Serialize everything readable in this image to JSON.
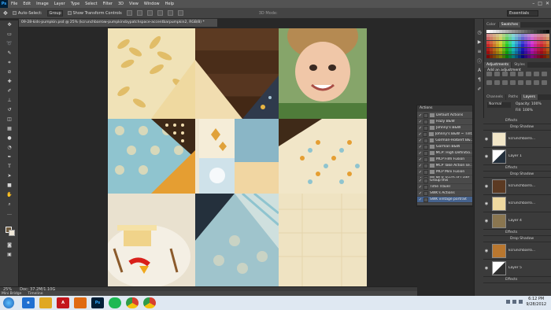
{
  "app": {
    "logo": "Ps",
    "menu": [
      "File",
      "Edit",
      "Image",
      "Layer",
      "Type",
      "Select",
      "Filter",
      "3D",
      "View",
      "Window",
      "Help"
    ],
    "window_controls": [
      "–",
      "□",
      "✕"
    ]
  },
  "options_bar": {
    "auto_select": "Auto-Select:",
    "group_value": "Group",
    "show_transform": "Show Transform Controls",
    "mode_3d": "3D Mode:",
    "workspace": "Essentials"
  },
  "document": {
    "tab_title": "09-28-kids-pumpkin.psd @ 25% (kcrunchbarrow-pumpkinsbypatchspace-accentbarpumpkin2, RGB/8) *"
  },
  "status": {
    "zoom": "25%",
    "doc_size": "Doc: 37.2M/1.10G"
  },
  "bottom_tabs": [
    "Mini Bridge",
    "Timeline"
  ],
  "panels": {
    "swatches_tabs": [
      "Color",
      "Swatches"
    ],
    "adjustments_tabs": [
      "Adjustments",
      "Styles"
    ],
    "adjustments_hint": "Add an adjustment",
    "layers_tabs": [
      "Channels",
      "Paths",
      "Layers"
    ],
    "blend_mode": "Normal",
    "opacity": "Opacity: 100%",
    "fill": "Fill: 100%",
    "layers": [
      {
        "name": "Effects",
        "kind": "fx"
      },
      {
        "name": "Drop Shadow",
        "kind": "fx"
      },
      {
        "name": "kcrunchbarro...",
        "kind": "layer"
      },
      {
        "name": "Layer 1",
        "kind": "layer"
      },
      {
        "name": "Effects",
        "kind": "fx"
      },
      {
        "name": "Drop Shadow",
        "kind": "fx"
      },
      {
        "name": "kcrunchbarro...",
        "kind": "layer"
      },
      {
        "name": "kcrunchbarro...",
        "kind": "layer"
      },
      {
        "name": "Layer 4",
        "kind": "layer"
      },
      {
        "name": "Effects",
        "kind": "fx"
      },
      {
        "name": "Drop Shadow",
        "kind": "fx"
      },
      {
        "name": "kcrunchbarro...",
        "kind": "layer"
      },
      {
        "name": "Layer 5",
        "kind": "layer"
      },
      {
        "name": "Effects",
        "kind": "fx"
      }
    ]
  },
  "actions": {
    "title": "Actions",
    "items": [
      {
        "label": "Default Actions"
      },
      {
        "label": "Hazy B&W"
      },
      {
        "label": "Johnny's B&W"
      },
      {
        "label": "Johnny's B&W ~ Tint..."
      },
      {
        "label": "Gorman-Holbert B&..."
      },
      {
        "label": "Gorman B&W"
      },
      {
        "label": "MCP: High Definitio..."
      },
      {
        "label": "MCP Film Fusion"
      },
      {
        "label": "MCP Take Action se..."
      },
      {
        "label": "MCP Mini Fusion"
      },
      {
        "label": "MCP Touch of Light..."
      },
      {
        "label": "Blue Glimmer Shadow"
      },
      {
        "label": "Marathon Mesh"
      },
      {
        "label": "Kimaratara"
      },
      {
        "label": "Group this"
      },
      {
        "label": "Time Travel"
      },
      {
        "label": "SWK's Actions"
      },
      {
        "label": "SWK vintage portrait"
      }
    ]
  },
  "taskbar": {
    "apps": [
      {
        "name": "ie",
        "color": "#1f6fd1",
        "label": "e"
      },
      {
        "name": "explorer",
        "color": "#e0a824",
        "label": ""
      },
      {
        "name": "acrobat",
        "color": "#c4161c",
        "label": "A"
      },
      {
        "name": "media",
        "color": "#e06a12",
        "label": ""
      },
      {
        "name": "photoshop",
        "color": "#001e36",
        "label": "Ps"
      },
      {
        "name": "spotify",
        "color": "#1db954",
        "label": ""
      },
      {
        "name": "chrome",
        "color": "#2f9b4a",
        "label": ""
      },
      {
        "name": "chrome-2",
        "color": "#d6402f",
        "label": ""
      }
    ],
    "time": "6:12 PM",
    "date": "9/28/2012"
  }
}
